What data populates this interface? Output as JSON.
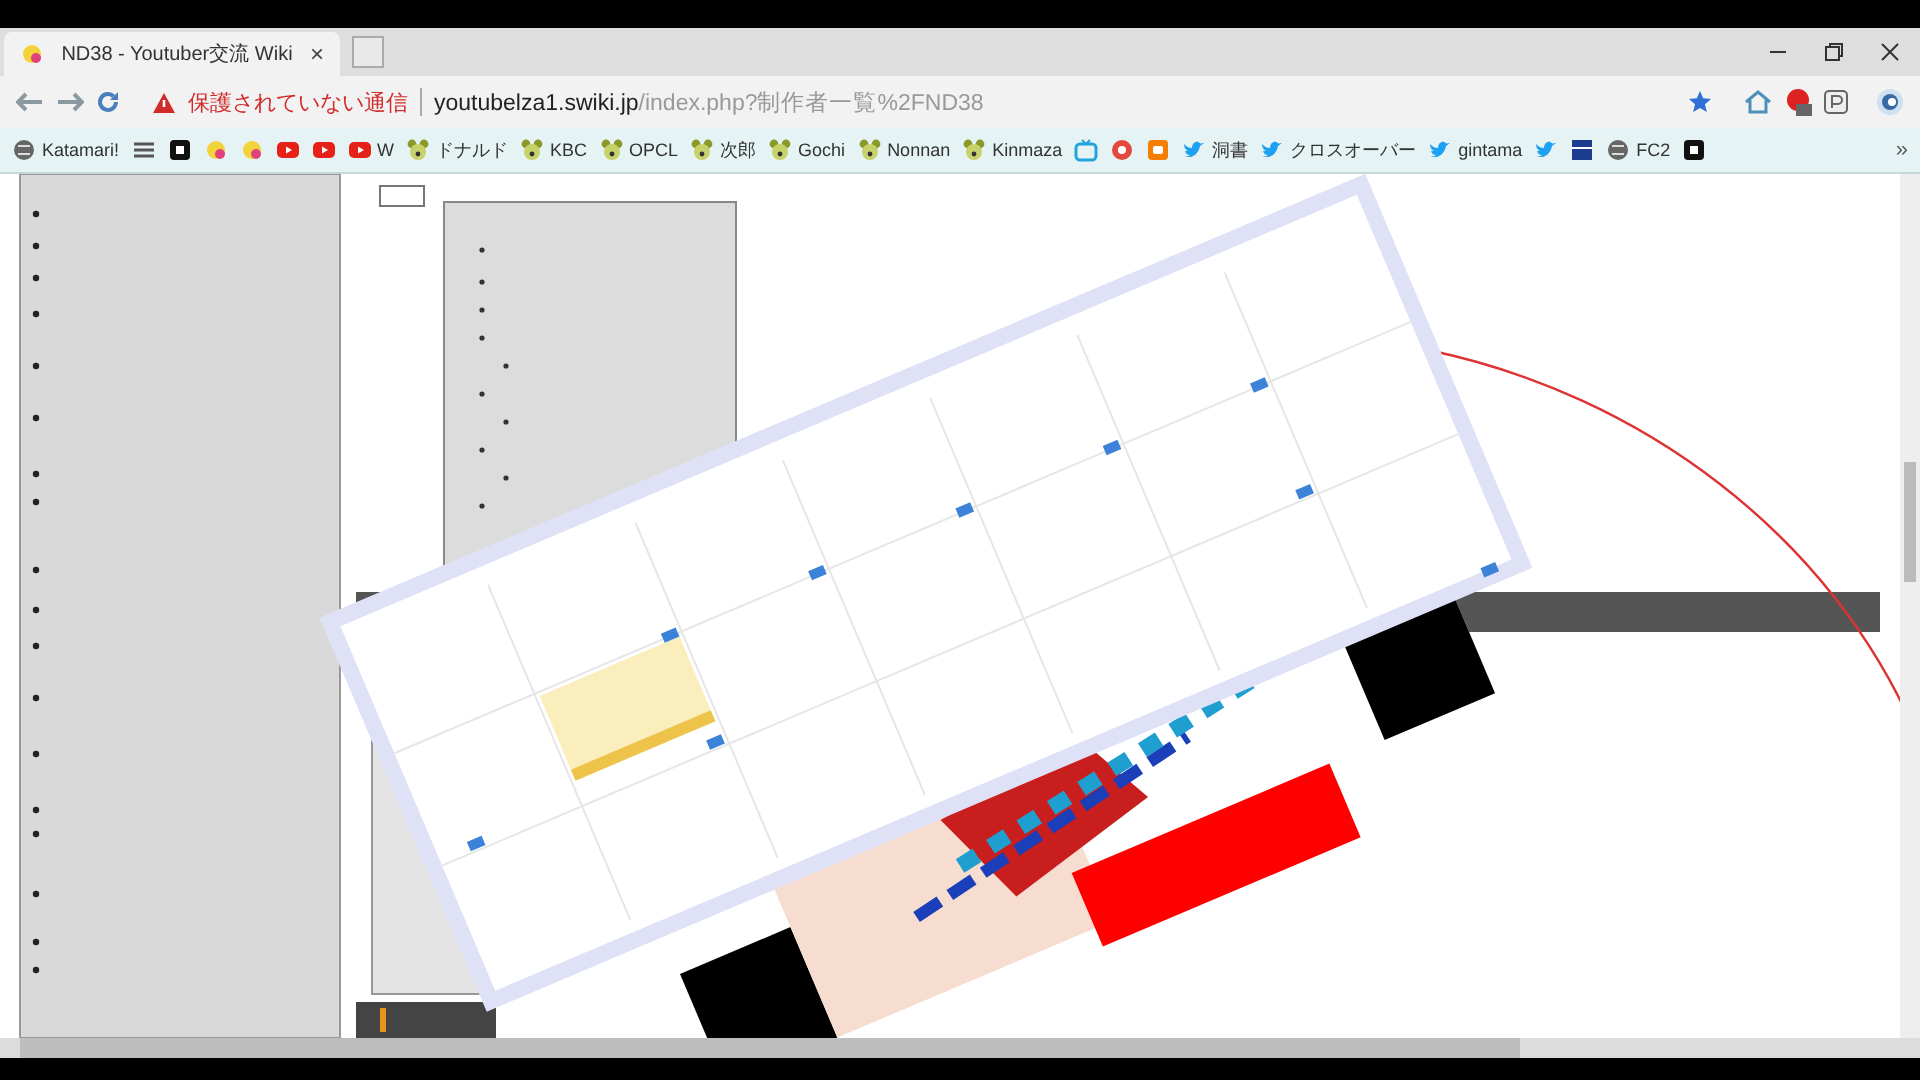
{
  "tab": {
    "title": "ND38 - Youtuber交流 Wiki",
    "close": "×",
    "selected": true
  },
  "address": {
    "warning": "保護されていない通信",
    "host": "youtubelza1.swiki.jp",
    "path": "/index.php?制作者一覧%2FND38"
  },
  "bookmarks": [
    {
      "kind": "globe",
      "label": "Katamari!"
    },
    {
      "kind": "list"
    },
    {
      "kind": "black"
    },
    {
      "kind": "chick"
    },
    {
      "kind": "chick"
    },
    {
      "kind": "youtube"
    },
    {
      "kind": "youtube"
    },
    {
      "kind": "youtube",
      "label": "W"
    },
    {
      "kind": "bear",
      "label": "ドナルド"
    },
    {
      "kind": "bear",
      "label": "KBC"
    },
    {
      "kind": "bear",
      "label": "OPCL"
    },
    {
      "kind": "bear",
      "label": "次郎"
    },
    {
      "kind": "bear",
      "label": "Gochi"
    },
    {
      "kind": "bear",
      "label": "Nonnan"
    },
    {
      "kind": "bear",
      "label": "Kinmaza"
    },
    {
      "kind": "tv"
    },
    {
      "kind": "redcircle"
    },
    {
      "kind": "blogger"
    },
    {
      "kind": "twitter",
      "label": "洞書"
    },
    {
      "kind": "twitter",
      "label": "クロスオーバー"
    },
    {
      "kind": "twitter",
      "label": "gintama"
    },
    {
      "kind": "twitter"
    },
    {
      "kind": "navy"
    },
    {
      "kind": "globe",
      "label": "FC2"
    },
    {
      "kind": "black"
    }
  ],
  "bookmarks_more": "»"
}
